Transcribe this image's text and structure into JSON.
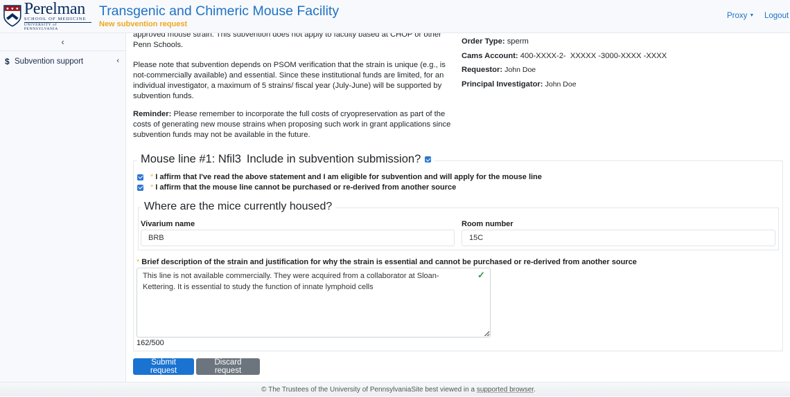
{
  "header": {
    "logo": {
      "name": "Perelman",
      "line1": "SCHOOL OF MEDICINE",
      "line2": "UNIVERSITY of PENNSYLVANIA"
    },
    "title": "Transgenic and Chimeric Mouse Facility",
    "subtitle": "New subvention request",
    "nav": {
      "proxy": "Proxy",
      "logout": "Logout"
    }
  },
  "sidebar": {
    "collapse_icon": "chevron-left-icon",
    "items": [
      {
        "icon": "dollar-icon",
        "label": "Subvention support",
        "chevron": "chevron-left-icon"
      }
    ]
  },
  "intro": {
    "paragraph1": "approved mouse strain. This subvention does not apply to faculty based at CHOP or other Penn Schools.",
    "paragraph2": "Please note that subvention depends on PSOM verification that the strain is unique (e.g., is not-commercially available) and essential. Since these institutional funds are limited, for an individual investigator, a maximum of 5 strains/ fiscal year (July-June) will be supported by subvention funds.",
    "reminder_label": "Reminder:",
    "reminder_text": "Please remember to incorporate the full costs of cryopreservation as part of the costs of generating new mouse strains when proposing such work in grant applications since subvention funds may not be available in the future."
  },
  "order_info": {
    "order_type_label": "Order Type:",
    "order_type": "sperm",
    "cams_label": "Cams Account:",
    "cams_value": "400-XXXX-2-  XXXXX -3000-XXXX -XXXX",
    "requestor_label": "Requestor:",
    "requestor": "John Doe",
    "pi_label": "Principal Investigator:",
    "pi": "John Doe"
  },
  "mouse_line": {
    "title": "Mouse line #1: Nfil3",
    "include_label": "Include in subvention submission?",
    "include_checked": true,
    "affirmations": [
      {
        "text": "I affirm that I've read the above statement and I am eligible for subvention and will apply for the mouse line",
        "checked": true
      },
      {
        "text": "I affirm that the mouse line cannot be purchased or re-derived from another source",
        "checked": true
      }
    ],
    "housing": {
      "title": "Where are the mice currently housed?",
      "vivarium_label": "Vivarium name",
      "vivarium_value": "BRB",
      "room_label": "Room number",
      "room_value": "15C"
    },
    "description": {
      "label": "Brief description of the strain and justification for why the strain is essential and cannot be purchased or re-derived from another source",
      "value": "This line is not available commercially. They were acquired from a collaborator at Sloan-Kettering. It is essential to study the function of innate lymphoid cells",
      "counter": "162/500",
      "valid_icon": "check-icon"
    }
  },
  "actions": {
    "submit": "Submit request",
    "discard": "Discard request"
  },
  "footer": {
    "copyright": "© The Trustees of the University of Pennsylvania",
    "note": "Site best viewed in a ",
    "link": "supported browser",
    "end": "."
  },
  "colors": {
    "brand_blue": "#1f72c4",
    "subtitle_amber": "#f0a81c",
    "primary_button": "#1a73d1",
    "secondary_button": "#6c757d",
    "valid_green": "#2f9a48"
  }
}
